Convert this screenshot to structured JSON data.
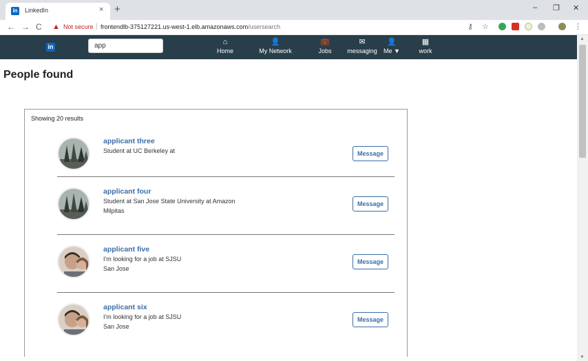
{
  "browser": {
    "tab_title": "LinkedIn",
    "tab_favicon": "in",
    "tab_close": "×",
    "new_tab": "+",
    "minimize": "–",
    "maximize": "❐",
    "close": "✕",
    "back": "←",
    "forward": "→",
    "reload": "C",
    "not_secure": "Not secure",
    "url_host": "frontendlb-375127221.us-west-1.elb.amazonaws.com",
    "url_path": "/usersearch"
  },
  "navbar": {
    "logo": "in",
    "search_value": "app",
    "items": [
      {
        "label": "Home",
        "icon": "home-icon",
        "glyph": "⌂"
      },
      {
        "label": "My Network",
        "icon": "person-icon",
        "glyph": "👤"
      },
      {
        "label": "Jobs",
        "icon": "briefcase-icon",
        "glyph": "💼"
      },
      {
        "label": "messaging",
        "icon": "envelope-icon",
        "glyph": "✉"
      },
      {
        "label": "Me ▼",
        "icon": "person-icon",
        "glyph": "👤"
      },
      {
        "label": "work",
        "icon": "grid-icon",
        "glyph": "▦"
      }
    ]
  },
  "page": {
    "title": "People found",
    "results_count": "Showing 20 results",
    "message_label": "Message",
    "results": [
      {
        "name": "applicant three",
        "line1": "Student at UC Berkeley at",
        "line2": "",
        "avatar": "trees"
      },
      {
        "name": "applicant four",
        "line1": "Student at San Jose State University at Amazon",
        "line2": "Milpitas",
        "avatar": "trees"
      },
      {
        "name": "applicant five",
        "line1": "I'm looking for a job at SJSU",
        "line2": "San Jose",
        "avatar": "people"
      },
      {
        "name": "applicant six",
        "line1": "I'm looking for a job at SJSU",
        "line2": "San Jose",
        "avatar": "people"
      }
    ]
  },
  "colors": {
    "navbar_bg": "#283e4a",
    "link_blue": "#3a6ea5",
    "brand_blue": "#0a66c2",
    "warning_red": "#c5221f"
  }
}
